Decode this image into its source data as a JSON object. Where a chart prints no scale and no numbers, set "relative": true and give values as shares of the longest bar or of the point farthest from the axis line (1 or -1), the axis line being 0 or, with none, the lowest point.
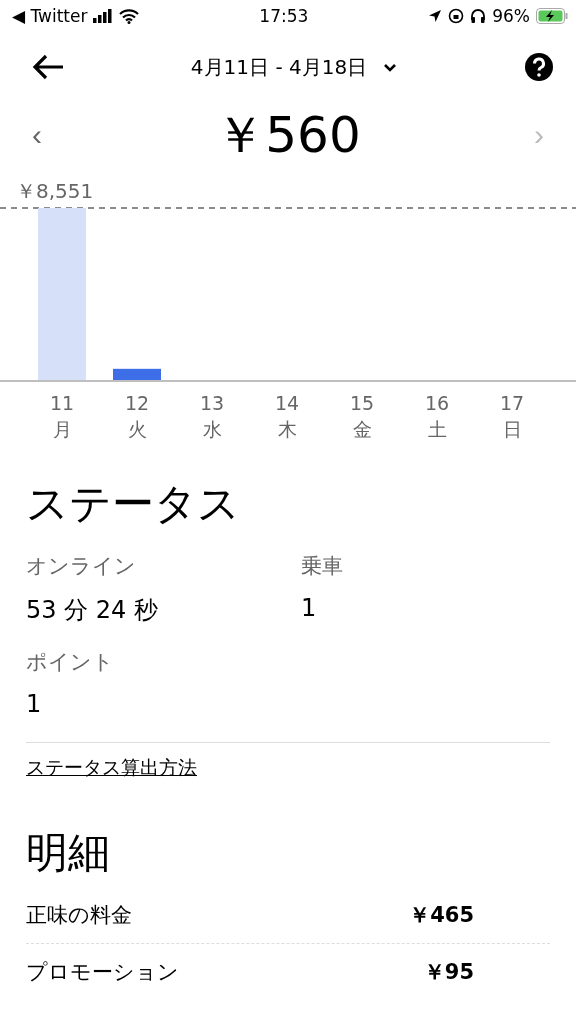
{
  "status_bar": {
    "back_app": "◀ Twitter",
    "time": "17:53",
    "battery": "96%"
  },
  "header": {
    "date_range": "4月11日 - 4月18日"
  },
  "total": {
    "previous": "‹",
    "amount": "￥560",
    "next": "›"
  },
  "earnings_chart": {
    "weekdays": [
      "月",
      "火",
      "水",
      "木",
      "金",
      "土",
      "日"
    ],
    "chart_data": {
      "type": "bar",
      "relative": true,
      "categories": [
        "11",
        "12",
        "13",
        "14",
        "15",
        "16",
        "17"
      ],
      "annotations": [
        {
          "text": "￥8,551"
        }
      ],
      "series": [
        {
          "color": "#d6e0f8",
          "values": [
            1,
            null,
            null,
            null,
            null,
            null,
            null
          ]
        },
        {
          "color": "#3d6ee8",
          "values": [
            null,
            0.065,
            null,
            null,
            null,
            null,
            null
          ]
        }
      ]
    }
  },
  "status": {
    "title": "ステータス",
    "stats": [
      {
        "label": "オンライン",
        "value": "53 分 24 秒"
      },
      {
        "label": "乗車",
        "value": "1"
      },
      {
        "label": "ポイント",
        "value": "1"
      }
    ],
    "link": "ステータス算出方法"
  },
  "breakdown": {
    "title": "明細",
    "rows": [
      {
        "label": "正味の料金",
        "value": "￥465"
      },
      {
        "label": "プロモーション",
        "value": "￥95"
      }
    ]
  }
}
